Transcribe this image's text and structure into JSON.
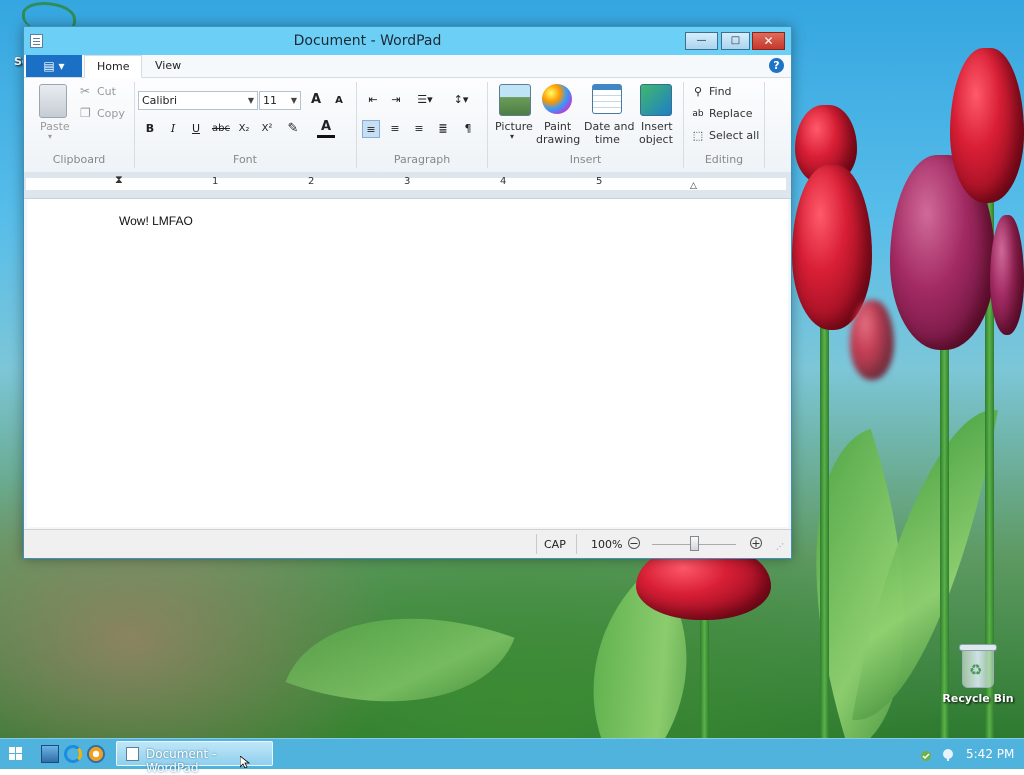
{
  "desktop": {
    "shortcut_label": "Se",
    "recycle_bin_label": "Recycle Bin"
  },
  "window": {
    "title": "Document - WordPad",
    "controls": {
      "minimize": "—",
      "maximize": "□",
      "close": "✕"
    }
  },
  "ribbon_tabs": {
    "app_menu_glyph": "▤ ▾",
    "home": "Home",
    "view": "View",
    "help": "?"
  },
  "ribbon": {
    "clipboard": {
      "paste": "Paste",
      "cut": "Cut",
      "copy": "Copy",
      "label": "Clipboard"
    },
    "font": {
      "family": "Calibri",
      "size": "11",
      "grow": "A",
      "shrink": "A",
      "bold": "B",
      "italic": "I",
      "underline": "U",
      "strikethrough": "abc",
      "subscript": "X₂",
      "superscript": "X²",
      "font_color": "A",
      "label": "Font"
    },
    "paragraph": {
      "label": "Paragraph"
    },
    "insert": {
      "picture": "Picture",
      "paint_1": "Paint",
      "paint_2": "drawing",
      "datetime_1": "Date and",
      "datetime_2": "time",
      "object_1": "Insert",
      "object_2": "object",
      "label": "Insert"
    },
    "editing": {
      "find": "Find",
      "replace": "Replace",
      "select_all": "Select all",
      "label": "Editing"
    }
  },
  "ruler": {
    "marks": [
      "1",
      "2",
      "3",
      "4",
      "5"
    ]
  },
  "document": {
    "text": "Wow! LMFAO"
  },
  "statusbar": {
    "caps": "CAP",
    "zoom": "100%",
    "zoom_out": "−",
    "zoom_in": "+"
  },
  "taskbar": {
    "active_task": "Document - WordPad",
    "clock": "5:42 PM"
  },
  "colors": {
    "titlebar": "#6ccff6",
    "taskbar": "#4fb3de",
    "app_menu": "#1b70c6"
  }
}
